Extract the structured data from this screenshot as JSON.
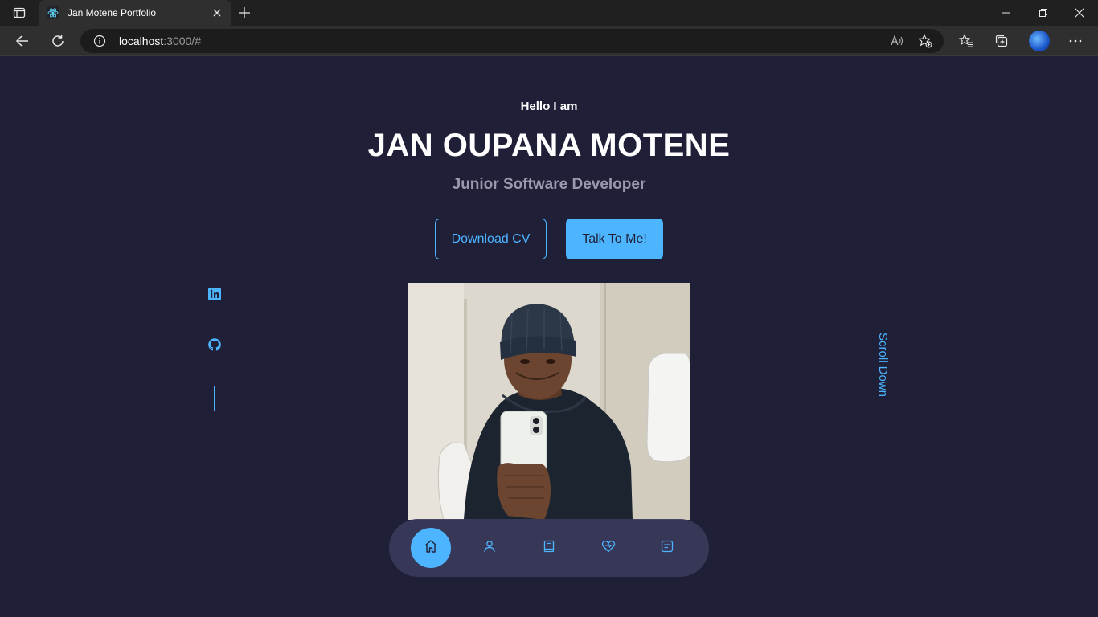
{
  "browser": {
    "tab_title": "Jan Motene Portfolio",
    "address_host": "localhost",
    "address_path": ":3000/#"
  },
  "header": {
    "greeting": "Hello I am",
    "name": "JAN OUPANA MOTENE",
    "role": "Junior Software Developer"
  },
  "cta": {
    "download_label": "Download CV",
    "talk_label": "Talk To Me!"
  },
  "socials": [
    "linkedin-icon",
    "github-icon"
  ],
  "scroll_label": "Scroll Down",
  "nav": {
    "items": [
      "home-icon",
      "user-icon",
      "book-icon",
      "services-icon",
      "message-icon"
    ],
    "active": "home-icon"
  },
  "colors": {
    "background": "#1f1f38",
    "accent": "#4db5ff",
    "muted": "#9a9aaf"
  }
}
